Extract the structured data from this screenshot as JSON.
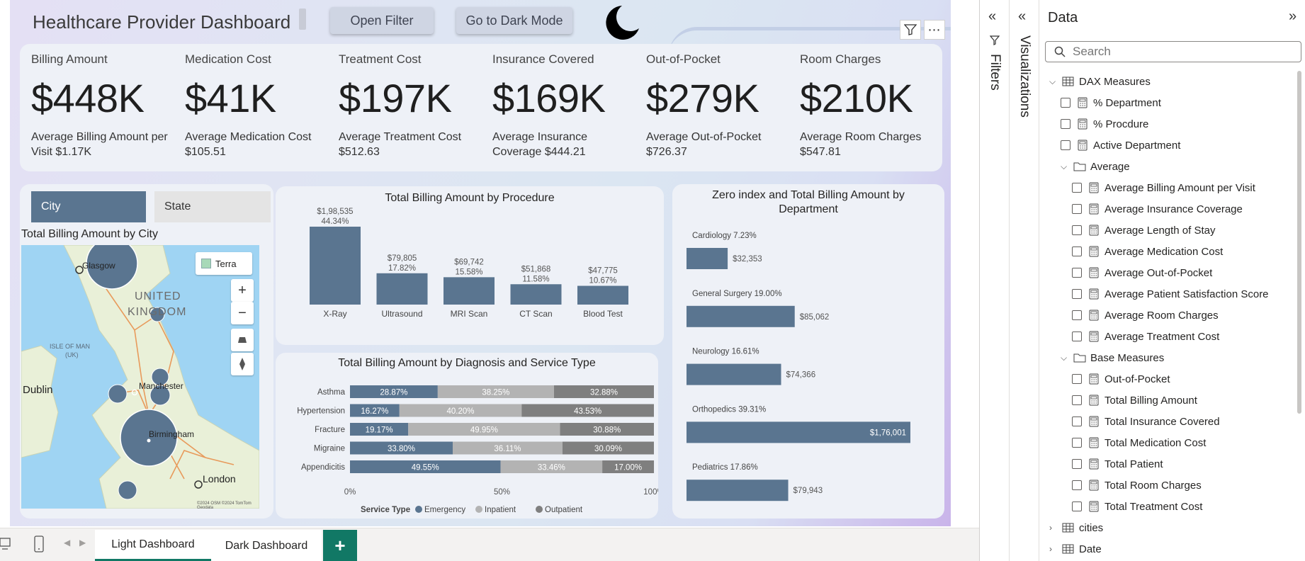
{
  "header": {
    "title": "Healthcare Provider Dashboard",
    "open_filter": "Open Filter",
    "dark_mode": "Go to Dark Mode"
  },
  "kpis": [
    {
      "label": "Billing Amount",
      "value": "$448K",
      "sub": "Average Billing Amount per Visit $1.17K"
    },
    {
      "label": "Medication Cost",
      "value": "$41K",
      "sub": "Average Medication Cost $105.51"
    },
    {
      "label": "Treatment Cost",
      "value": "$197K",
      "sub": "Average Treatment Cost $512.63"
    },
    {
      "label": "Insurance Covered",
      "value": "$169K",
      "sub": "Average Insurance Coverage $444.21"
    },
    {
      "label": "Out-of-Pocket",
      "value": "$279K",
      "sub": "Average Out-of-Pocket $726.37"
    },
    {
      "label": "Room Charges",
      "value": "$210K",
      "sub": "Average Room Charges $547.81"
    }
  ],
  "slicer": {
    "city": "City",
    "state": "State"
  },
  "map": {
    "title": "Total Billing Amount by City",
    "style_label": "Terra",
    "labels": {
      "glasgow": "Glasgow",
      "uk_line1": "UNITED",
      "uk_line2": "KINGDOM",
      "isle_line1": "ISLE OF MAN",
      "isle_line2": "(UK)",
      "dublin": "Dublin",
      "manchester": "Manchester",
      "birmingham": "Birmingham",
      "london": "London"
    },
    "zoom_in": "+",
    "zoom_out": "−",
    "attribution": "©2024 OSM ©2024 TomTom Geodata",
    "colors": {
      "water": "#9fd4f3",
      "land": "#e9f0d8",
      "bubble": "#5a7590"
    }
  },
  "chart_data": [
    {
      "type": "bar",
      "title": "Total Billing Amount by Procedure",
      "categories": [
        "X-Ray",
        "Ultrasound",
        "MRI Scan",
        "CT Scan",
        "Blood Test"
      ],
      "values": [
        198535,
        79805,
        69742,
        51868,
        47775
      ],
      "value_labels": [
        "$1,98,535",
        "$79,805",
        "$69,742",
        "$51,868",
        "$47,775"
      ],
      "percent_labels": [
        "44.34%",
        "17.82%",
        "15.58%",
        "11.58%",
        "10.67%"
      ],
      "color": "#5a7590"
    },
    {
      "type": "bar",
      "orientation": "horizontal-stacked-100",
      "title": "Total Billing Amount by Diagnosis and Service Type",
      "categories": [
        "Asthma",
        "Hypertension",
        "Fracture",
        "Migraine",
        "Appendicitis"
      ],
      "series": [
        {
          "name": "Emergency",
          "color": "#5a7590",
          "values": [
            28.87,
            16.27,
            19.17,
            33.8,
            49.55
          ],
          "labels": [
            "28.87%",
            "16.27%",
            "19.17%",
            "33.80%",
            "49.55%"
          ]
        },
        {
          "name": "Inpatient",
          "color": "#b3b3b3",
          "values": [
            38.25,
            40.2,
            49.95,
            36.11,
            33.46
          ],
          "labels": [
            "38.25%",
            "40.20%",
            "49.95%",
            "36.11%",
            "33.46%"
          ]
        },
        {
          "name": "Outpatient",
          "color": "#7f7f7f",
          "values": [
            32.88,
            43.53,
            30.88,
            30.09,
            17.0
          ],
          "labels": [
            "32.88%",
            "43.53%",
            "30.88%",
            "30.09%",
            "17.00%"
          ]
        }
      ],
      "x_ticks": [
        "0%",
        "50%",
        "100%"
      ],
      "xlim": [
        0,
        100
      ],
      "legend_title": "Service Type",
      "legend_position": "bottom"
    },
    {
      "type": "bar",
      "orientation": "horizontal",
      "title": "Zero index and Total Billing Amount by Department",
      "categories": [
        "Cardiology 7.23%",
        "General Surgery 19.00%",
        "Neurology 16.61%",
        "Orthopedics 39.31%",
        "Pediatrics 17.86%"
      ],
      "values": [
        32353,
        85062,
        74366,
        176001,
        79943
      ],
      "value_labels": [
        "$32,353",
        "$85,062",
        "$74,366",
        "$1,76,001",
        "$79,943"
      ],
      "color": "#5a7590"
    }
  ],
  "tabs": {
    "light": "Light Dashboard",
    "dark": "Dark Dashboard",
    "add": "+"
  },
  "panes": {
    "filters": "Filters",
    "visualizations": "Visualizations"
  },
  "data_pane": {
    "title": "Data",
    "search_placeholder": "Search",
    "tree": [
      {
        "level": 0,
        "kind": "table",
        "label": "DAX Measures",
        "expanded": true
      },
      {
        "level": 1,
        "kind": "measure",
        "label": "% Department"
      },
      {
        "level": 1,
        "kind": "measure",
        "label": "% Procdure"
      },
      {
        "level": 1,
        "kind": "measure",
        "label": "Active Department"
      },
      {
        "level": 1,
        "kind": "folder",
        "label": "Average",
        "expanded": true
      },
      {
        "level": 2,
        "kind": "measure",
        "label": "Average Billing Amount per Visit"
      },
      {
        "level": 2,
        "kind": "measure",
        "label": "Average Insurance Coverage"
      },
      {
        "level": 2,
        "kind": "measure",
        "label": "Average Length of Stay"
      },
      {
        "level": 2,
        "kind": "measure",
        "label": "Average Medication Cost"
      },
      {
        "level": 2,
        "kind": "measure",
        "label": "Average Out-of-Pocket"
      },
      {
        "level": 2,
        "kind": "measure",
        "label": "Average Patient Satisfaction Score"
      },
      {
        "level": 2,
        "kind": "measure",
        "label": "Average Room Charges"
      },
      {
        "level": 2,
        "kind": "measure",
        "label": "Average Treatment Cost"
      },
      {
        "level": 1,
        "kind": "folder",
        "label": "Base Measures",
        "expanded": true
      },
      {
        "level": 2,
        "kind": "measure",
        "label": "Out-of-Pocket"
      },
      {
        "level": 2,
        "kind": "measure",
        "label": "Total Billing Amount"
      },
      {
        "level": 2,
        "kind": "measure",
        "label": "Total Insurance Covered"
      },
      {
        "level": 2,
        "kind": "measure",
        "label": "Total Medication Cost"
      },
      {
        "level": 2,
        "kind": "measure",
        "label": "Total Patient"
      },
      {
        "level": 2,
        "kind": "measure",
        "label": "Total Room Charges"
      },
      {
        "level": 2,
        "kind": "measure",
        "label": "Total Treatment Cost"
      },
      {
        "level": 0,
        "kind": "table",
        "label": "cities",
        "expanded": false
      },
      {
        "level": 0,
        "kind": "table",
        "label": "Date",
        "expanded": false
      }
    ]
  },
  "colors": {
    "accent": "#117865",
    "bar": "#5a7590",
    "slicer_selected": "#5a7590"
  }
}
